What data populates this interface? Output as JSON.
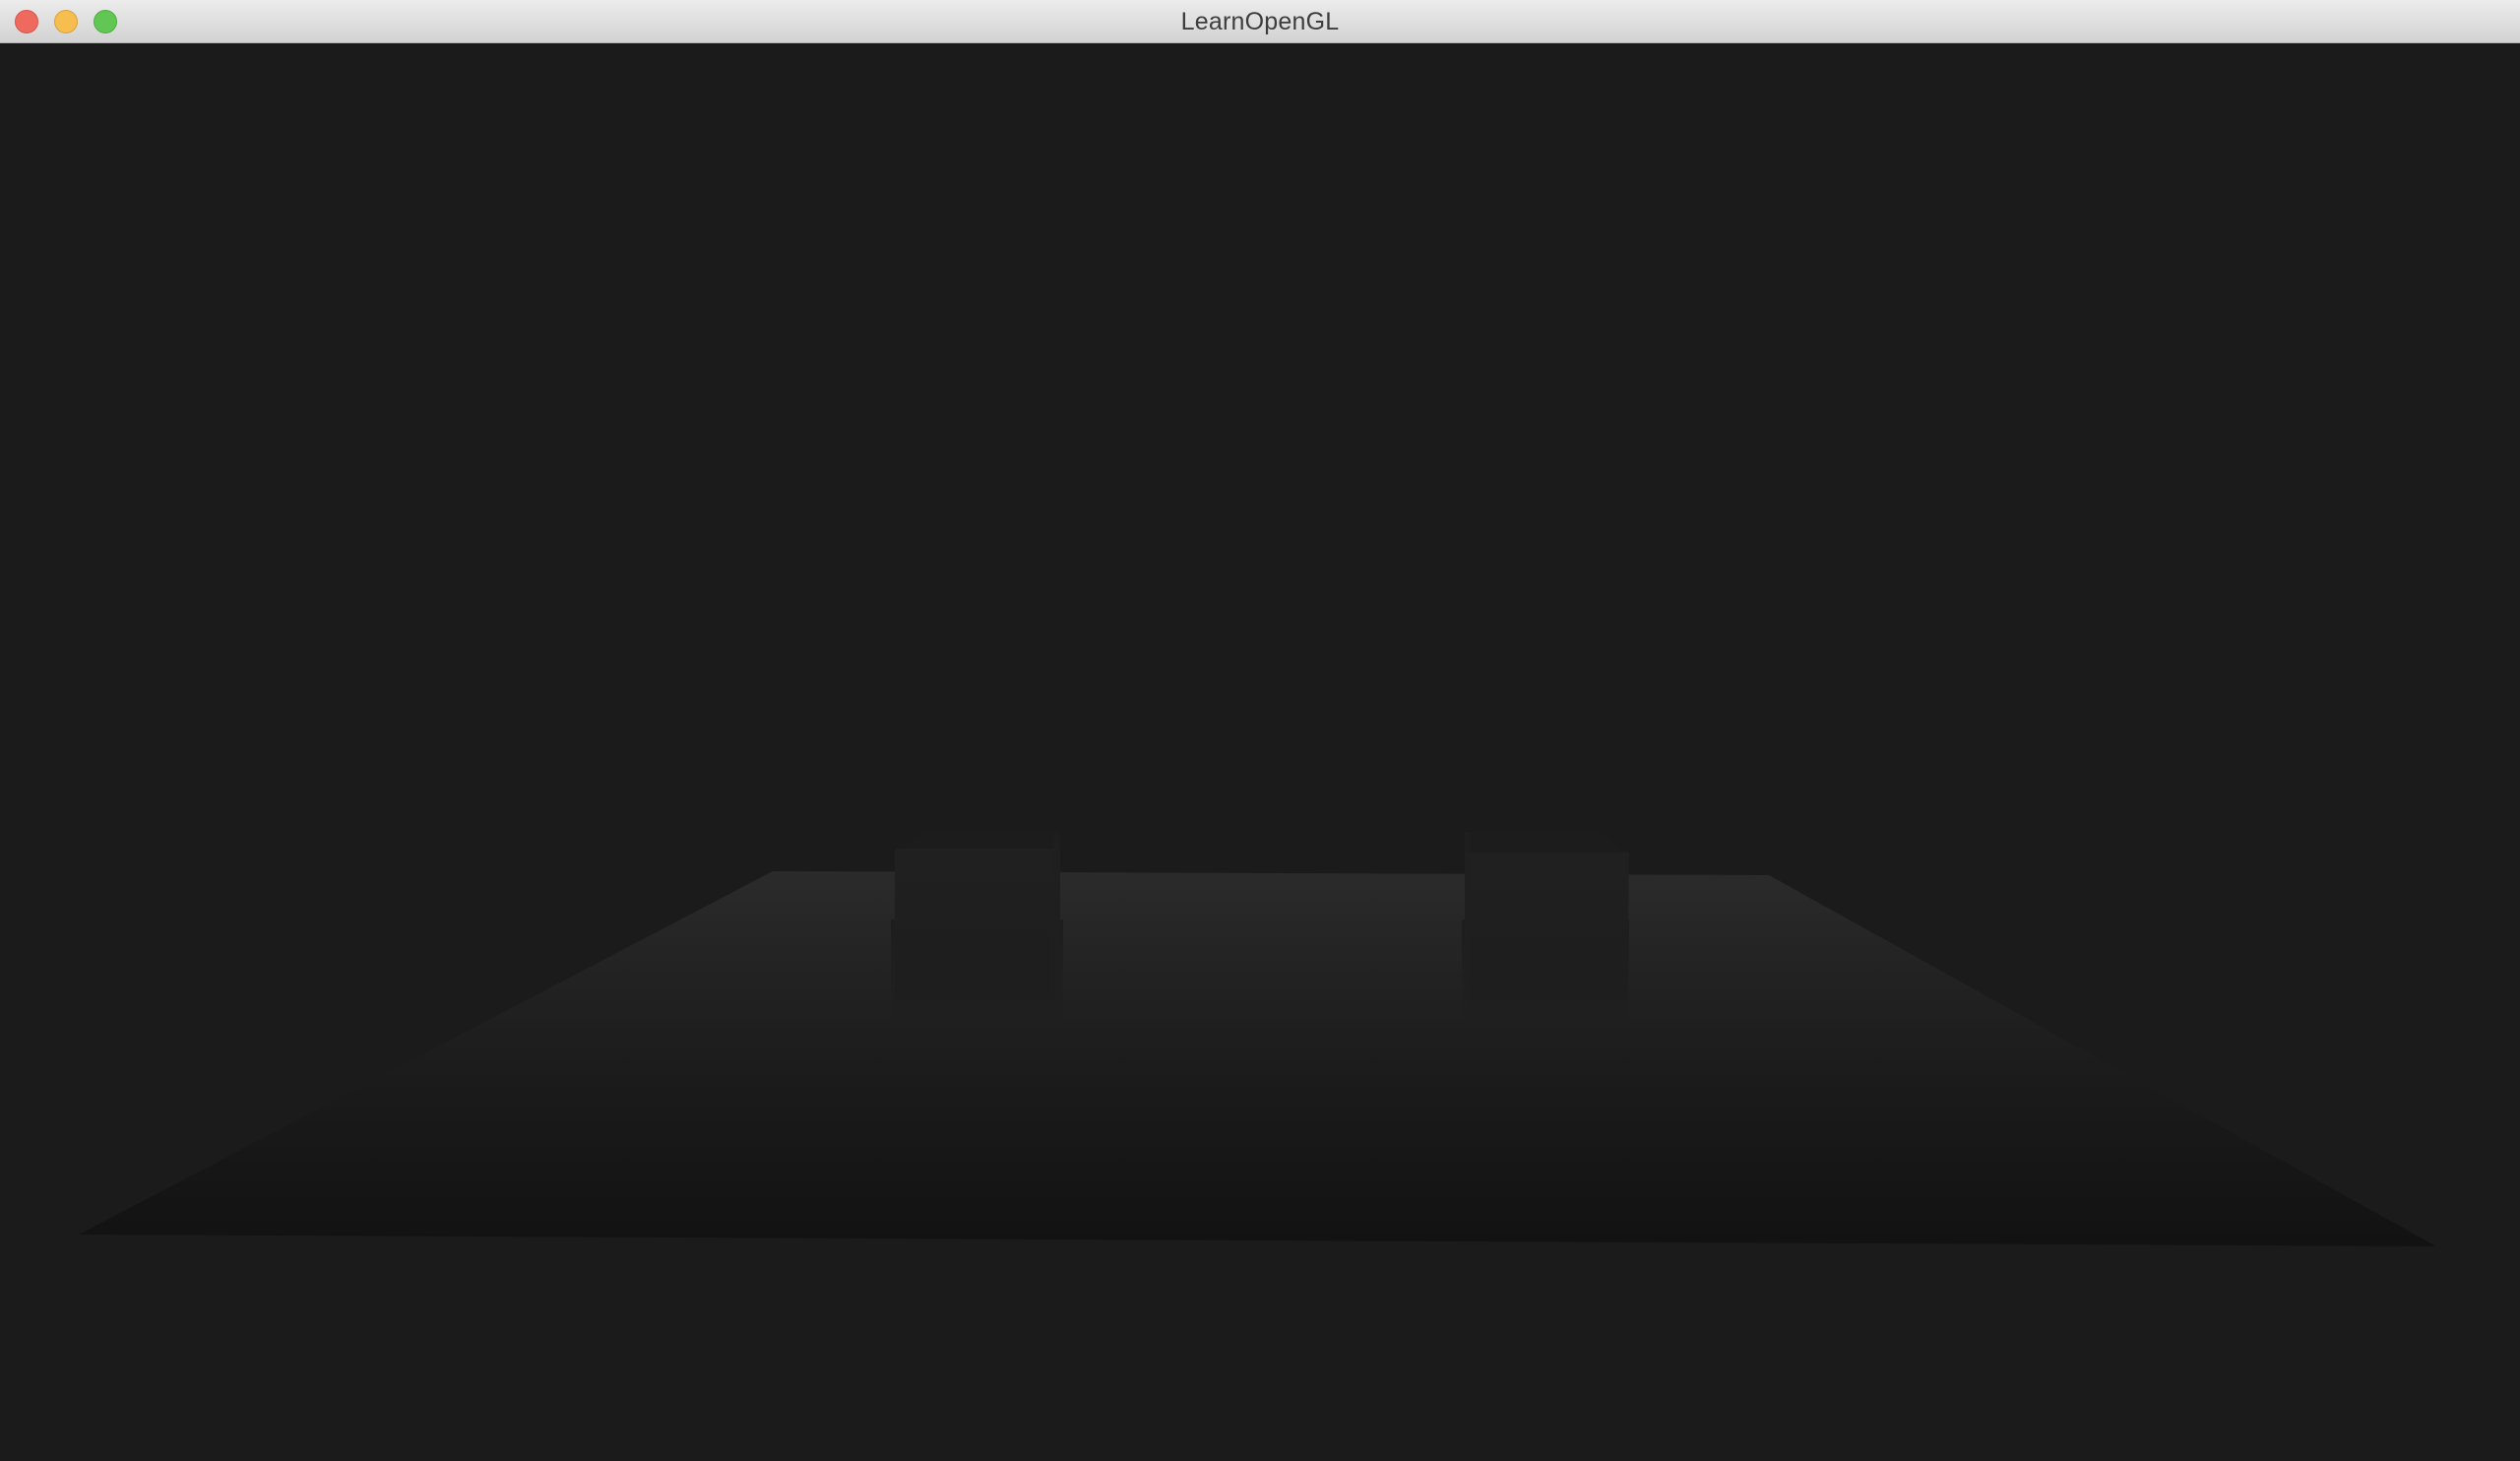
{
  "window": {
    "title": "LearnOpenGL",
    "controls": {
      "close": "close-icon",
      "minimize": "minimize-icon",
      "zoom": "zoom-icon"
    }
  },
  "colors": {
    "clear_color": "#1b1b1b",
    "floor_far": "#2a2a2a",
    "floor_near": "#121212",
    "cube_face": "#1f1f1f",
    "cube_top": "#1c1c1c"
  }
}
